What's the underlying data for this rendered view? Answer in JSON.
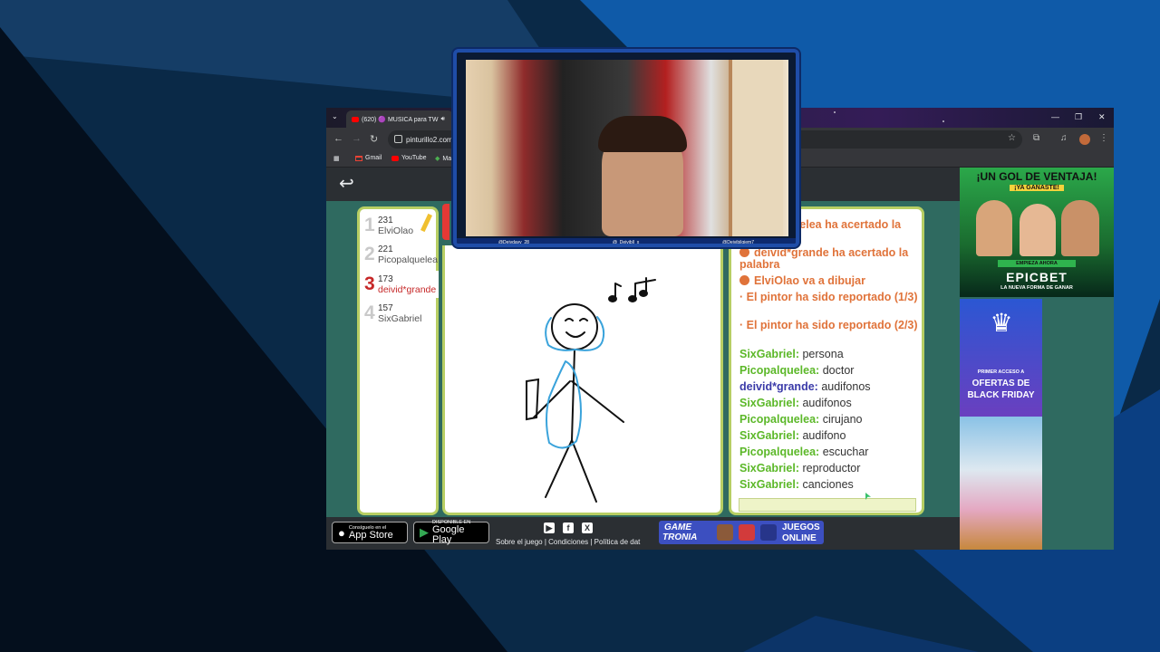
{
  "browser": {
    "tab_title": "(620) 🟣 MUSICA para TW",
    "url": "pinturillo2.com",
    "bookmarks": [
      "Gmail",
      "YouTube",
      "Ma"
    ]
  },
  "game": {
    "players": [
      {
        "rank": "1",
        "score": "231",
        "name": "ElviOlao",
        "drawing": true
      },
      {
        "rank": "2",
        "score": "221",
        "name": "Picopalquelea"
      },
      {
        "rank": "3",
        "score": "173",
        "name": "deivid*grande",
        "highlight": true
      },
      {
        "rank": "4",
        "score": "157",
        "name": "SixGabriel"
      }
    ],
    "system_messages": [
      "quelea ha acertado la",
      "deivid*grande ha acertado la palabra",
      "ElviOlao va a dibujar",
      "· El pintor ha sido reportado (1/3)",
      "· El pintor ha sido reportado (2/3)"
    ],
    "chat": [
      {
        "user": "SixGabriel:",
        "text": "persona",
        "color": "#5cb829"
      },
      {
        "user": "Picopalquelea:",
        "text": "doctor",
        "color": "#5cb829"
      },
      {
        "user": "deivid*grande:",
        "text": "audifonos",
        "color": "#3a3aa8"
      },
      {
        "user": "SixGabriel:",
        "text": "audifonos",
        "color": "#5cb829"
      },
      {
        "user": "Picopalquelea:",
        "text": "cirujano",
        "color": "#5cb829"
      },
      {
        "user": "SixGabriel:",
        "text": "audifono",
        "color": "#5cb829"
      },
      {
        "user": "Picopalquelea:",
        "text": "escuchar",
        "color": "#5cb829"
      },
      {
        "user": "SixGabriel:",
        "text": "reproductor",
        "color": "#5cb829"
      },
      {
        "user": "SixGabriel:",
        "text": "canciones",
        "color": "#5cb829"
      }
    ]
  },
  "footer": {
    "appstore_small": "Consíguelo en el",
    "appstore_big": "App Store",
    "googleplay_small": "DISPONIBLE EN",
    "googleplay_big": "Google Play",
    "links": "Sobre el juego | Condiciones | Política de dat",
    "gametronia_1": "GAME",
    "gametronia_2": "TRONIA",
    "juegos": "JUEGOS",
    "online": "ONLINE"
  },
  "ads": {
    "ad1_headline": "¡UN GOL DE VENTAJA!",
    "ad1_sub": "¡YA GANASTE!",
    "ad1_cta": "EMPIEZA AHORA",
    "ad1_brand": "EPICBET",
    "ad1_tagline": "LA NUEVA FORMA DE GANAR",
    "ad2_small": "PRIMER ACCESO A",
    "ad2_big1": "OFERTAS DE",
    "ad2_big2": "BLACK FRIDAY"
  },
  "webcam": {
    "handles": [
      "@Deivdavv_28",
      "@_Deivibll_x",
      "@Deivibilgiem7"
    ]
  },
  "colors": {
    "panel_border": "#b7ce63",
    "system_msg": "#e0733a",
    "highlight_player": "#c62828"
  }
}
